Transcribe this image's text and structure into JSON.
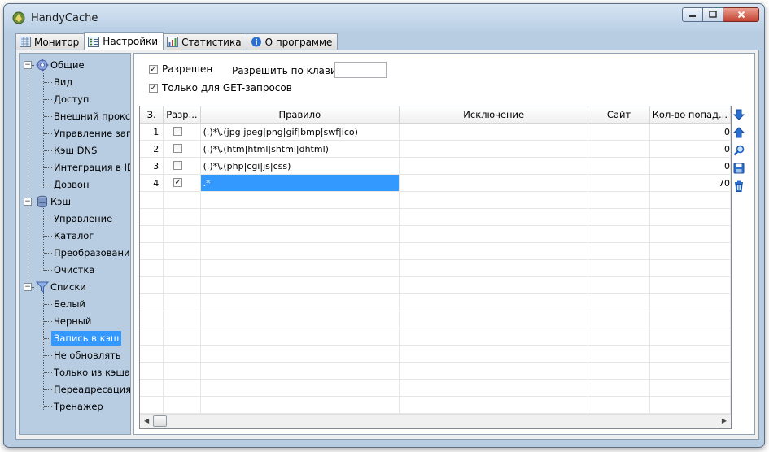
{
  "window": {
    "title": "HandyCache"
  },
  "tabs": [
    {
      "label": "Монитор",
      "icon": "monitor-icon"
    },
    {
      "label": "Настройки",
      "icon": "settings-icon"
    },
    {
      "label": "Статистика",
      "icon": "statistics-icon"
    },
    {
      "label": "О программе",
      "icon": "info-icon"
    }
  ],
  "tree": {
    "groups": [
      {
        "label": "Общие",
        "icon": "gear-icon",
        "items": [
          "Вид",
          "Доступ",
          "Внешний прокси",
          "Управление загру",
          "Кэш DNS",
          "Интеграция в IE",
          "Дозвон"
        ]
      },
      {
        "label": "Кэш",
        "icon": "database-icon",
        "items": [
          "Управление",
          "Каталог",
          "Преобразование I",
          "Очистка"
        ]
      },
      {
        "label": "Списки",
        "icon": "filter-icon",
        "items": [
          "Белый",
          "Черный",
          "Запись в кэш",
          "Не обновлять",
          "Только из кэша",
          "Переадресация",
          "Тренажер"
        ]
      }
    ],
    "selected": "Запись в кэш"
  },
  "options": {
    "enabled_label": "Разрешен",
    "enabled_checked": true,
    "hotkey_label": "Разрешить по клавише:",
    "hotkey_value": "",
    "get_only_label": "Только для GET-запросов",
    "get_only_checked": true
  },
  "grid": {
    "columns": [
      "З.",
      "Разр...",
      "Правило",
      "Исключение",
      "Сайт",
      "Кол-во попад..."
    ],
    "rows": [
      {
        "num": "1",
        "enabled": false,
        "rule": "(.)*\\.(jpg|jpeg|png|gif|bmp|swf|ico)",
        "exception": "",
        "site": "",
        "count": "0"
      },
      {
        "num": "2",
        "enabled": false,
        "rule": "(.)*\\.(htm|html|shtml|dhtml)",
        "exception": "",
        "site": "",
        "count": "0"
      },
      {
        "num": "3",
        "enabled": false,
        "rule": "(.)*\\.(php|cgi|js|css)",
        "exception": "",
        "site": "",
        "count": "0"
      },
      {
        "num": "4",
        "enabled": true,
        "rule": ".*",
        "exception": "",
        "site": "",
        "count": "70"
      }
    ],
    "empty_rows": 13
  },
  "side_tools": [
    "move-down-icon",
    "move-up-icon",
    "search-icon",
    "save-icon",
    "delete-icon"
  ]
}
